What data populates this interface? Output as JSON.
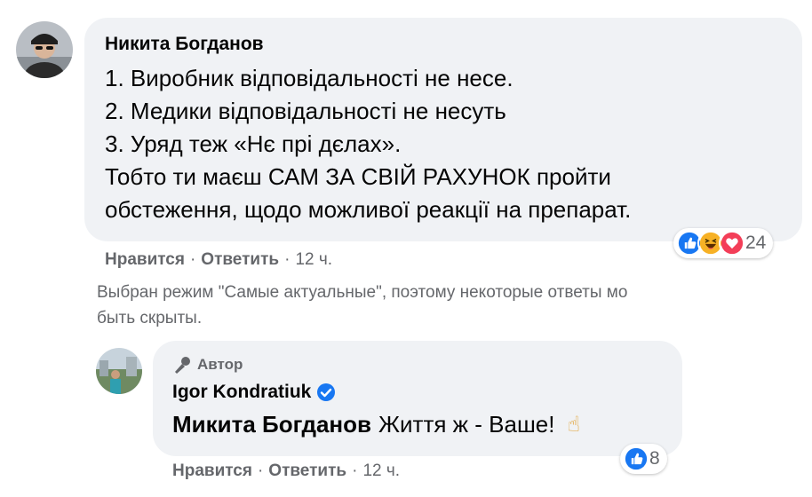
{
  "comment1": {
    "author": "Никита Богданов",
    "lines": [
      "1. Виробник відповідальності не несе.",
      "2. Медики відповідальності не несуть",
      "3. Уряд теж «Нє прі дєлах».",
      "Тобто ти маєш САМ ЗА СВІЙ РАХУНОК пройти",
      "обстеження, щодо можливої реакції на препарат."
    ],
    "actions": {
      "like": "Нравится",
      "reply": "Ответить",
      "time": "12 ч."
    },
    "reactions": {
      "icons": [
        "like-icon",
        "haha-icon",
        "love-icon"
      ],
      "count": "24"
    }
  },
  "notice": {
    "line1": "Выбран режим \"Самые актуальные\", поэтому некоторые ответы мо",
    "line2": "быть скрыты."
  },
  "reply": {
    "badge": "Автор",
    "author": "Igor Kondratiuk",
    "mention": "Микита Богданов",
    "text": "Життя ж - Ваше!",
    "emoji": "☝",
    "actions": {
      "like": "Нравится",
      "reply": "Ответить",
      "time": "12 ч."
    },
    "reactions": {
      "icons": [
        "like-icon"
      ],
      "count": "8"
    }
  },
  "colors": {
    "like": "#1877f2",
    "haha": "#f7b125",
    "love": "#f33e58",
    "bubble": "#f0f2f5",
    "meta": "#65676b"
  }
}
